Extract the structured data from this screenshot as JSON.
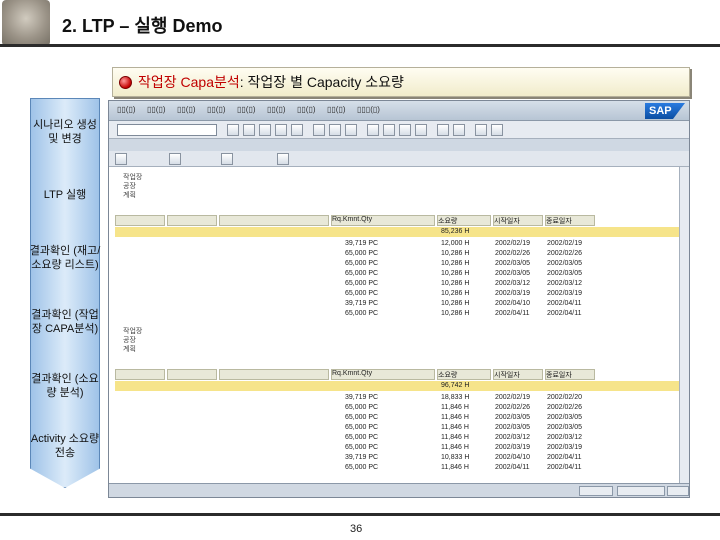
{
  "slide": {
    "title": "2. LTP – 실행 Demo",
    "page_number": "36"
  },
  "subtitle": {
    "accent_text": "작업장 Capa분석",
    "rest_text": ": 작업장 별 Capacity 소요량"
  },
  "flow_steps": [
    "시나리오 생성 및 변경",
    "LTP 실행",
    "결과확인 (재고/소요량 리스트)",
    "결과확인 (작업장 CAPA분석)",
    "결과확인 (소요량 분석)",
    "Activity 소요량 전송"
  ],
  "sap": {
    "logo": "SAP",
    "columns": [
      "Rq.Kmnt.Qty",
      "소요량",
      "시작일자",
      "종료일자"
    ],
    "tables": [
      {
        "header_fields": [
          "작업장",
          "공장",
          "계획"
        ],
        "total": "85,236 H",
        "rows": [
          {
            "qty": "39,719 PC",
            "req": "12,000 H",
            "start": "2002/02/19",
            "end": "2002/02/19"
          },
          {
            "qty": "65,000 PC",
            "req": "10,286 H",
            "start": "2002/02/26",
            "end": "2002/02/26"
          },
          {
            "qty": "65,000 PC",
            "req": "10,286 H",
            "start": "2002/03/05",
            "end": "2002/03/05"
          },
          {
            "qty": "65,000 PC",
            "req": "10,286 H",
            "start": "2002/03/05",
            "end": "2002/03/05"
          },
          {
            "qty": "65,000 PC",
            "req": "10,286 H",
            "start": "2002/03/12",
            "end": "2002/03/12"
          },
          {
            "qty": "65,000 PC",
            "req": "10,286 H",
            "start": "2002/03/19",
            "end": "2002/03/19"
          },
          {
            "qty": "39,719 PC",
            "req": "10,286 H",
            "start": "2002/04/10",
            "end": "2002/04/11"
          },
          {
            "qty": "65,000 PC",
            "req": "10,286 H",
            "start": "2002/04/11",
            "end": "2002/04/11"
          }
        ]
      },
      {
        "header_fields": [
          "작업장",
          "공장",
          "계획"
        ],
        "total": "96,742 H",
        "rows": [
          {
            "qty": "39,719 PC",
            "req": "18,833 H",
            "start": "2002/02/19",
            "end": "2002/02/20"
          },
          {
            "qty": "65,000 PC",
            "req": "11,846 H",
            "start": "2002/02/26",
            "end": "2002/02/26"
          },
          {
            "qty": "65,000 PC",
            "req": "11,846 H",
            "start": "2002/03/05",
            "end": "2002/03/05"
          },
          {
            "qty": "65,000 PC",
            "req": "11,846 H",
            "start": "2002/03/05",
            "end": "2002/03/05"
          },
          {
            "qty": "65,000 PC",
            "req": "11,846 H",
            "start": "2002/03/12",
            "end": "2002/03/12"
          },
          {
            "qty": "65,000 PC",
            "req": "11,846 H",
            "start": "2002/03/19",
            "end": "2002/03/19"
          },
          {
            "qty": "39,719 PC",
            "req": "10,833 H",
            "start": "2002/04/10",
            "end": "2002/04/11"
          },
          {
            "qty": "65,000 PC",
            "req": "11,846 H",
            "start": "2002/04/11",
            "end": "2002/04/11"
          }
        ]
      }
    ]
  }
}
